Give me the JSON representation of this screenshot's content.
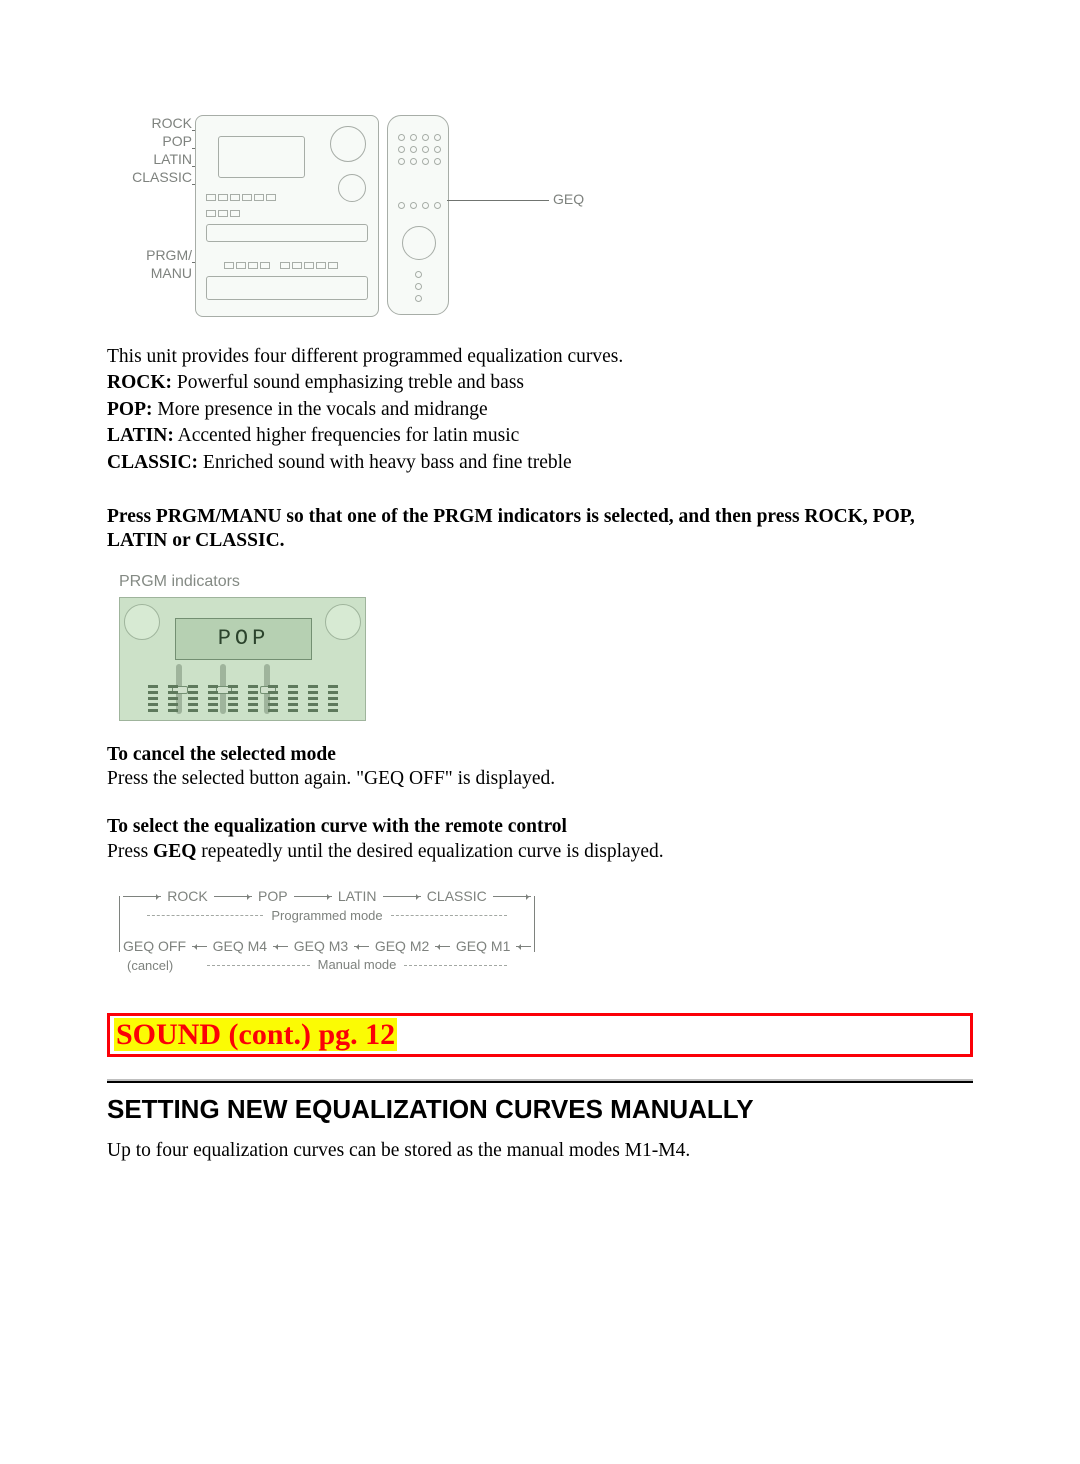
{
  "diagram1": {
    "left_labels": [
      "ROCK",
      "POP",
      "LATIN",
      "CLASSIC",
      "PRGM/",
      "MANU"
    ],
    "remote_label": "GEQ"
  },
  "intro": {
    "lead_in": "This unit provides four different programmed equalization curves.",
    "items": [
      {
        "name": "ROCK:",
        "desc": "  Powerful sound emphasizing treble and bass"
      },
      {
        "name": "POP:",
        "desc": "  More presence in the vocals and midrange"
      },
      {
        "name": "LATIN:",
        "desc": " Accented higher frequencies for latin music"
      },
      {
        "name": "CLASSIC:",
        "desc": "  Enriched sound with heavy bass and fine treble"
      }
    ],
    "instruction": "Press PRGM/MANU so that one of the PRGM indicators is selected, and then press ROCK, POP, LATIN or CLASSIC."
  },
  "diagram2": {
    "caption": "PRGM indicators",
    "display_text": "POP"
  },
  "cancel": {
    "header": "To cancel the selected mode",
    "body": "Press the selected button again. \"GEQ OFF\" is displayed."
  },
  "remote_select": {
    "header": "To select the equalization curve with the remote control",
    "body_pre": "Press ",
    "body_key": "GEQ",
    "body_post": " repeatedly until the desired equalization curve is displayed."
  },
  "diagram3": {
    "top_row": [
      "ROCK",
      "POP",
      "LATIN",
      "CLASSIC"
    ],
    "top_caption": "Programmed mode",
    "bottom_row": [
      "GEQ OFF",
      "GEQ M4",
      "GEQ M3",
      "GEQ M2",
      "GEQ M1"
    ],
    "bottom_caption": "Manual mode",
    "cancel_note": "(cancel)"
  },
  "redbar": "SOUND (cont.) pg. 12",
  "section": {
    "title": "SETTING NEW EQUALIZATION CURVES MANUALLY",
    "body": "Up to four equalization curves can be stored as the manual modes M1-M4."
  }
}
